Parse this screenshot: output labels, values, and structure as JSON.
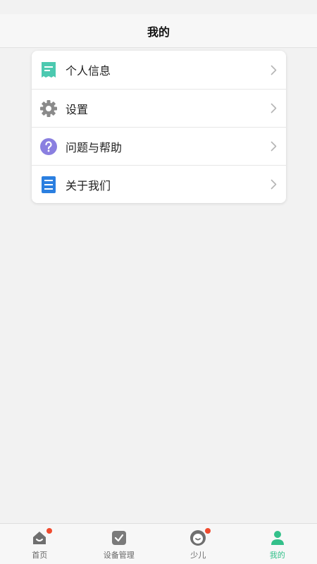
{
  "header": {
    "title": "我的"
  },
  "menu": {
    "items": [
      {
        "label": "个人信息",
        "icon": "profile-document-icon",
        "color": "#4cc9b0"
      },
      {
        "label": "设置",
        "icon": "gear-icon",
        "color": "#8a8a8a"
      },
      {
        "label": "问题与帮助",
        "icon": "question-icon",
        "color": "#8a7fe0"
      },
      {
        "label": "关于我们",
        "icon": "document-list-icon",
        "color": "#2b7fe0"
      }
    ]
  },
  "tabbar": {
    "items": [
      {
        "label": "首页",
        "icon": "home-icon",
        "badge": true,
        "active": false
      },
      {
        "label": "设备管理",
        "icon": "check-box-icon",
        "badge": false,
        "active": false
      },
      {
        "label": "少儿",
        "icon": "child-face-icon",
        "badge": true,
        "active": false
      },
      {
        "label": "我的",
        "icon": "user-icon",
        "badge": false,
        "active": true
      }
    ],
    "active_color": "#33c08a",
    "badge_color": "#f04a2e"
  }
}
